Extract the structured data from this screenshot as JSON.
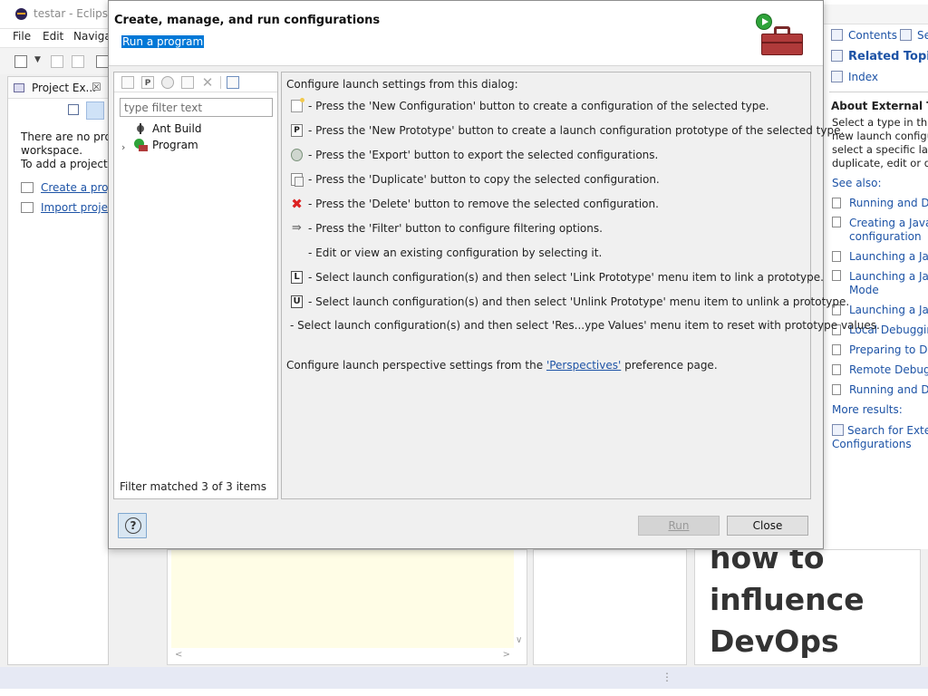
{
  "background": {
    "window_title": "testar - Eclipse I",
    "menu": [
      "File",
      "Edit",
      "Navigat"
    ],
    "explorer": {
      "tab_label": "Project Ex...",
      "message": "There are no projec\nworkspace.\nTo add a project:",
      "links": [
        "Create a proj",
        "Import proje"
      ]
    },
    "devops_text": "how to\ninfluence\nDevOps"
  },
  "help": {
    "nav": {
      "contents": "Contents",
      "search": "Se",
      "related_topics": "Related Topics",
      "index": "Index"
    },
    "about_title": "About External Tool",
    "about_text": "Select a type in this t\nnew launch configur\nselect a specific laun\nduplicate, edit or del",
    "see_also": "See also:",
    "links": [
      "Running and De",
      "Creating a Java a\nconfiguration",
      "Launching a Java",
      "Launching a Java\nMode",
      "Launching a Java",
      "Local Debugging",
      "Preparing to Deb",
      "Remote Debugg",
      "Running and De"
    ],
    "more_results": "More results:",
    "search_external": "Search for Extern\nConfigurations"
  },
  "dialog": {
    "title": "Create, manage, and run configurations",
    "subtitle": "Run a program",
    "filter_placeholder": "type filter text",
    "tree": [
      {
        "label": "Ant Build"
      },
      {
        "label": "Program"
      }
    ],
    "filter_status": "Filter matched 3 of 3 items",
    "info": {
      "intro": "Configure launch settings from this dialog:",
      "lines": [
        "- Press the 'New Configuration' button to create a configuration of the selected type.",
        "- Press the 'New Prototype' button to create a launch configuration prototype of the selected type.",
        "- Press the 'Export' button to export the selected configurations.",
        "- Press the 'Duplicate' button to copy the selected configuration.",
        "- Press the 'Delete' button to remove the selected configuration.",
        "- Press the 'Filter' button to configure filtering options.",
        "- Edit or view an existing configuration by selecting it.",
        "- Select launch configuration(s) and then select 'Link Prototype' menu item to link a prototype.",
        "- Select launch configuration(s) and then select 'Unlink Prototype' menu item to unlink a prototype.",
        "- Select launch configuration(s) and then select 'Res...ype Values' menu item to reset with prototype values."
      ],
      "perspective_prefix": "Configure launch perspective settings from the ",
      "perspective_link": "'Perspectives'",
      "perspective_suffix": " preference page."
    },
    "buttons": {
      "run": "Run",
      "close": "Close",
      "help": "?"
    }
  }
}
